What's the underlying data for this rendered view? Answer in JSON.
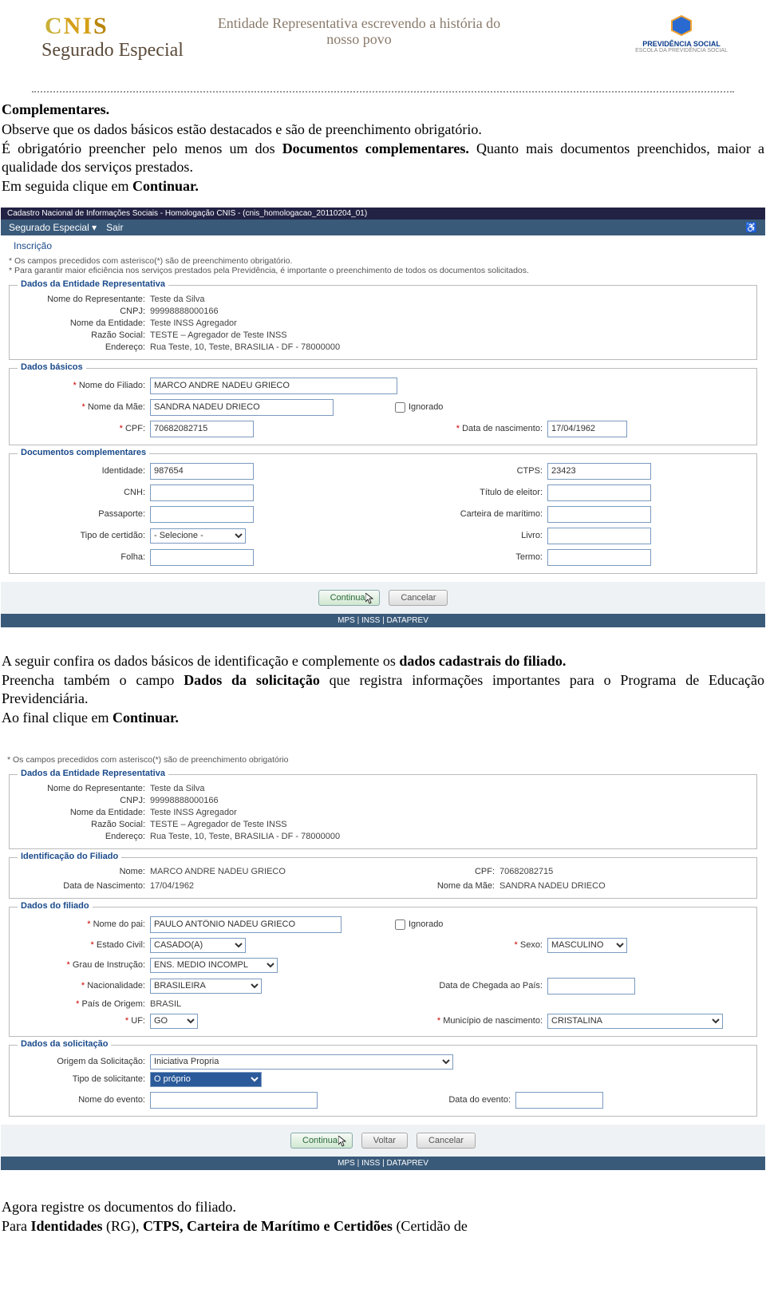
{
  "banner": {
    "logo_main": "CNIS",
    "logo_sub": "Segurado Especial",
    "script_text": "Entidade Representativa escrevendo a história do nosso povo",
    "prev_label1": "PREVIDÊNCIA SOCIAL",
    "prev_label2": "ESCOLA DA PREVIDÊNCIA SOCIAL"
  },
  "para1": {
    "l1a": "Complementares.",
    "l2a": "Observe que os dados básicos estão destacados e são de preenchimento obrigatório.",
    "l3a": "É obrigatório preencher pelo menos um dos ",
    "l3b": "Documentos complementares.",
    "l4a": " Quanto mais documentos preenchidos, maior a qualidade dos serviços prestados.",
    "l5a": "Em seguida clique em ",
    "l5b": "Continuar."
  },
  "ss1": {
    "topbar": "Cadastro Nacional de Informações Sociais - Homologação CNIS - (cnis_homologacao_20110204_01)",
    "nav": {
      "item1": "Segurado Especial ▾",
      "item2": "Sair"
    },
    "tab": "Inscrição",
    "note1": "* Os campos precedidos com asterisco(*) são de preenchimento obrigatório.",
    "note2": "* Para garantir maior eficiência nos serviços prestados pela Previdência, é importante o preenchimento de todos os documentos solicitados.",
    "entidade": {
      "legend": "Dados da Entidade Representativa",
      "rep_lbl": "Nome do Representante:",
      "rep_val": "Teste da Silva",
      "cnpj_lbl": "CNPJ:",
      "cnpj_val": "99998888000166",
      "ent_lbl": "Nome da Entidade:",
      "ent_val": "Teste INSS Agregador",
      "razao_lbl": "Razão Social:",
      "razao_val": "TESTE – Agregador de Teste INSS",
      "end_lbl": "Endereço:",
      "end_val": "Rua Teste, 10, Teste, BRASILIA - DF - 78000000"
    },
    "basicos": {
      "legend": "Dados básicos",
      "filiado_lbl": "Nome do Filiado:",
      "filiado_val": "MARCO ANDRE NADEU GRIECO",
      "mae_lbl": "Nome da Mãe:",
      "mae_val": "SANDRA NADEU DRIECO",
      "ignorado": "Ignorado",
      "cpf_lbl": "CPF:",
      "cpf_val": "70682082715",
      "nasc_lbl": "Data de nascimento:",
      "nasc_val": "17/04/1962"
    },
    "docs": {
      "legend": "Documentos complementares",
      "ident_lbl": "Identidade:",
      "ident_val": "987654",
      "ctps_lbl": "CTPS:",
      "ctps_val": "23423",
      "cnh_lbl": "CNH:",
      "titulo_lbl": "Título de eleitor:",
      "pass_lbl": "Passaporte:",
      "marit_lbl": "Carteira de marítimo:",
      "tipo_lbl": "Tipo de certidão:",
      "tipo_val": "- Selecione -",
      "livro_lbl": "Livro:",
      "folha_lbl": "Folha:",
      "termo_lbl": "Termo:"
    },
    "btn_continue": "Continuar",
    "btn_cancel": "Cancelar",
    "footer": "MPS | INSS | DATAPREV"
  },
  "para2": {
    "l1a": "A seguir confira os dados básicos de identificação e complemente os ",
    "l1b": "dados cadastrais do filiado.",
    "l2a": "Preencha também o campo ",
    "l2b": "Dados da solicitação",
    "l2c": " que registra informações importantes para o Programa de Educação Previdenciária.",
    "l3a": "Ao final clique em ",
    "l3b": "Continuar."
  },
  "ss2": {
    "note1": "* Os campos precedidos com asterisco(*) são de preenchimento obrigatório",
    "entidade": {
      "legend": "Dados da Entidade Representativa",
      "rep_lbl": "Nome do Representante:",
      "rep_val": "Teste da Silva",
      "cnpj_lbl": "CNPJ:",
      "cnpj_val": "99998888000166",
      "ent_lbl": "Nome da Entidade:",
      "ent_val": "Teste INSS Agregador",
      "razao_lbl": "Razão Social:",
      "razao_val": "TESTE – Agregador de Teste INSS",
      "end_lbl": "Endereço:",
      "end_val": "Rua Teste, 10, Teste, BRASILIA - DF - 78000000"
    },
    "ident": {
      "legend": "Identificação do Filiado",
      "nome_lbl": "Nome:",
      "nome_val": "MARCO ANDRE NADEU GRIECO",
      "cpf_lbl": "CPF:",
      "cpf_val": "70682082715",
      "nasc_lbl": "Data de Nascimento:",
      "nasc_val": "17/04/1962",
      "mae_lbl": "Nome da Mãe:",
      "mae_val": "SANDRA NADEU DRIECO"
    },
    "filiado": {
      "legend": "Dados do filiado",
      "pai_lbl": "Nome do pai:",
      "pai_val": "PAULO ANTÔNIO NADEU GRIECO",
      "ignorado": "Ignorado",
      "estciv_lbl": "Estado Civil:",
      "estciv_val": "CASADO(A)",
      "sexo_lbl": "Sexo:",
      "sexo_val": "MASCULINO",
      "grau_lbl": "Grau de Instrução:",
      "grau_val": "ENS. MEDIO INCOMPL",
      "nac_lbl": "Nacionalidade:",
      "nac_val": "BRASILEIRA",
      "cheg_lbl": "Data de Chegada ao País:",
      "pais_lbl": "País de Origem:",
      "pais_val": "BRASIL",
      "uf_lbl": "UF:",
      "uf_val": "GO",
      "mun_lbl": "Município de nascimento:",
      "mun_val": "CRISTALINA"
    },
    "solic": {
      "legend": "Dados da solicitação",
      "orig_lbl": "Origem da Solicitação:",
      "orig_val": "Iniciativa Propria",
      "tipo_lbl": "Tipo de solicitante:",
      "tipo_val": "O próprio",
      "evnome_lbl": "Nome do evento:",
      "evdata_lbl": "Data do evento:"
    },
    "btn_continue": "Continuar",
    "btn_back": "Voltar",
    "btn_cancel": "Cancelar",
    "footer": "MPS | INSS | DATAPREV"
  },
  "para3": {
    "l1": "Agora registre os documentos do filiado.",
    "l2a": "Para ",
    "l2b": "Identidades",
    "l2c": " (RG), ",
    "l2d": "CTPS, Carteira de Marítimo e Certidões",
    "l2e": " (Certidão de"
  }
}
